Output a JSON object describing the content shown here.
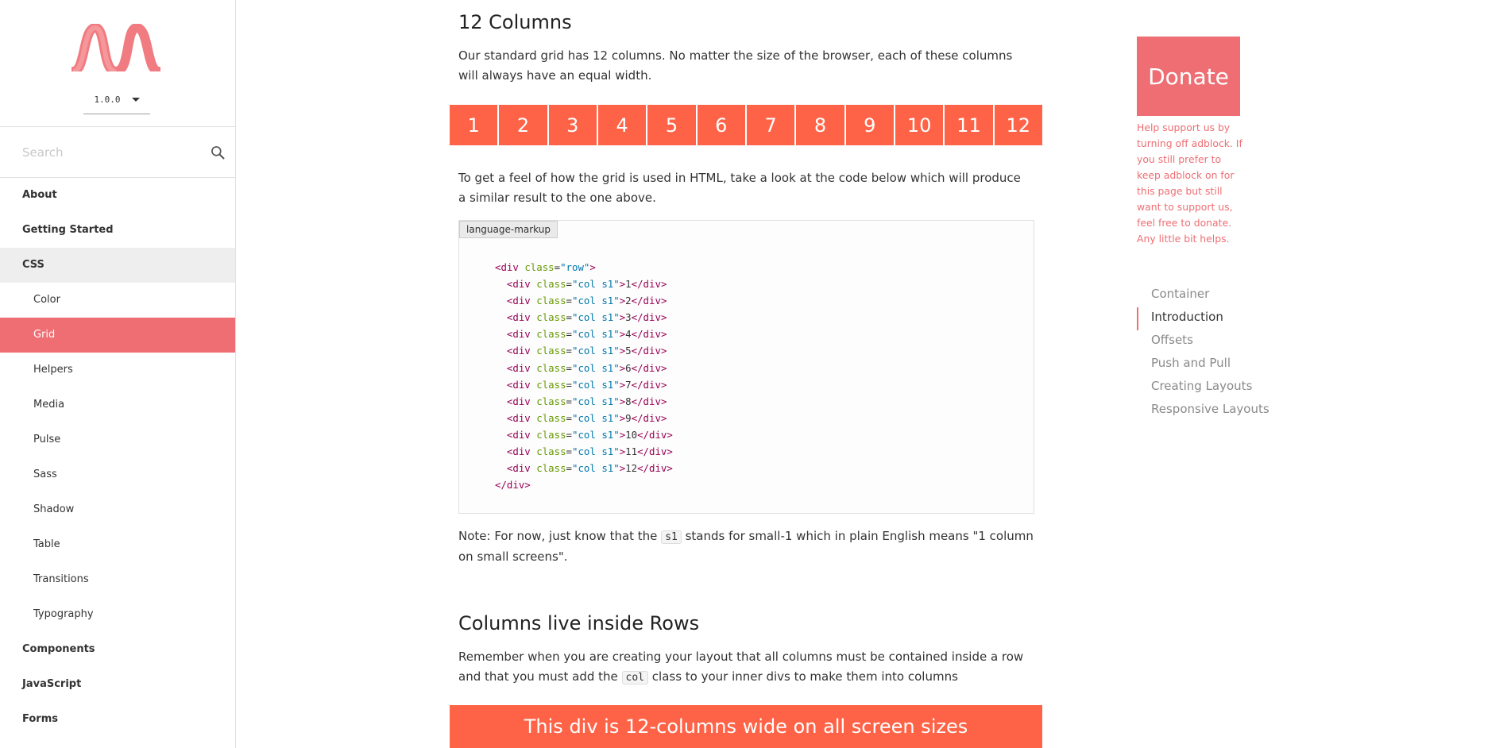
{
  "sidebar": {
    "version": "1.0.0",
    "search_placeholder": "Search",
    "items": [
      {
        "label": "About",
        "level": "top"
      },
      {
        "label": "Getting Started",
        "level": "top"
      },
      {
        "label": "CSS",
        "level": "top"
      },
      {
        "label": "Color",
        "level": "sub"
      },
      {
        "label": "Grid",
        "level": "sub"
      },
      {
        "label": "Helpers",
        "level": "sub"
      },
      {
        "label": "Media",
        "level": "sub"
      },
      {
        "label": "Pulse",
        "level": "sub"
      },
      {
        "label": "Sass",
        "level": "sub"
      },
      {
        "label": "Shadow",
        "level": "sub"
      },
      {
        "label": "Table",
        "level": "sub"
      },
      {
        "label": "Transitions",
        "level": "sub"
      },
      {
        "label": "Typography",
        "level": "sub"
      },
      {
        "label": "Components",
        "level": "top"
      },
      {
        "label": "JavaScript",
        "level": "top"
      },
      {
        "label": "Forms",
        "level": "top"
      }
    ]
  },
  "main": {
    "heading_12": "12 Columns",
    "para_1": "Our standard grid has 12 columns. No matter the size of the browser, each of these columns will always have an equal width.",
    "grid_cells": [
      "1",
      "2",
      "3",
      "4",
      "5",
      "6",
      "7",
      "8",
      "9",
      "10",
      "11",
      "12"
    ],
    "para_2": "To get a feel of how the grid is used in HTML, take a look at the code below which will produce a similar result to the one above.",
    "code_label": "language-markup",
    "code": {
      "open_tag": "<div",
      "attr": "class",
      "eq": "=",
      "row_class": "\"row\"",
      "gt": ">",
      "col_class": "\"col s1\"",
      "close_div": "</div>",
      "lines": [
        "1",
        "2",
        "3",
        "4",
        "5",
        "6",
        "7",
        "8",
        "9",
        "10",
        "11",
        "12"
      ]
    },
    "note_prefix": "Note: For now, just know that the ",
    "note_code": "s1",
    "note_suffix": " stands for small-1 which in plain English means \"1 column on small screens\".",
    "heading_live": "Columns live inside Rows",
    "para_4_prefix": "Remember when you are creating your layout that all columns must be contained inside a row and that you must add the ",
    "para_4_code": "col",
    "para_4_suffix": " class to your inner divs to make them into columns",
    "banner": "This div is 12-columns wide on all screen sizes"
  },
  "right": {
    "donate_label": "Donate",
    "donate_text": "Help support us by turning off adblock. If you still prefer to keep adblock on for this page but still want to support us, feel free to donate. Any little bit helps.",
    "toc": [
      "Container",
      "Introduction",
      "Offsets",
      "Push and Pull",
      "Creating Layouts",
      "Responsive Layouts"
    ]
  },
  "colors": {
    "accent": "#ee6e73",
    "grid_cell": "#ff6347"
  }
}
